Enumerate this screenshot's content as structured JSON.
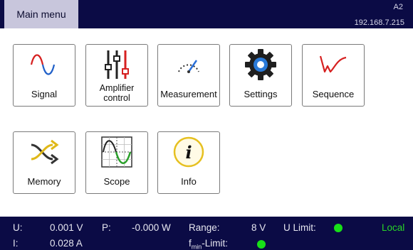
{
  "header": {
    "menu_title": "Main menu",
    "device_id": "A2",
    "ip_address": "192.168.7.215",
    "bar_color": "#0b0b45"
  },
  "tiles": {
    "signal": {
      "label": "Signal",
      "icon": "sine-wave-icon"
    },
    "amplifier": {
      "label_line1": "Amplifier",
      "label_line2": "control",
      "icon": "sliders-icon"
    },
    "measurement": {
      "label": "Measurement",
      "icon": "gauge-icon"
    },
    "settings": {
      "label": "Settings",
      "icon": "gear-icon"
    },
    "sequence": {
      "label": "Sequence",
      "icon": "sequence-wave-icon"
    },
    "memory": {
      "label": "Memory",
      "icon": "shuffle-icon"
    },
    "scope": {
      "label": "Scope",
      "icon": "oscilloscope-icon"
    },
    "info": {
      "label": "Info",
      "icon": "info-icon"
    }
  },
  "status": {
    "u_label": "U:",
    "u_value": "0.001 V",
    "p_label": "P:",
    "p_value": "-0.000 W",
    "range_label": "Range:",
    "range_value": "8 V",
    "u_limit_label": "U Limit:",
    "u_limit_state_color": "#18e018",
    "mode": "Local",
    "i_label": "I:",
    "i_value": "0.028 A",
    "fmin_limit_main": "f",
    "fmin_limit_sub": "min",
    "fmin_limit_rest": "-Limit:",
    "fmin_limit_state_color": "#18e018"
  }
}
